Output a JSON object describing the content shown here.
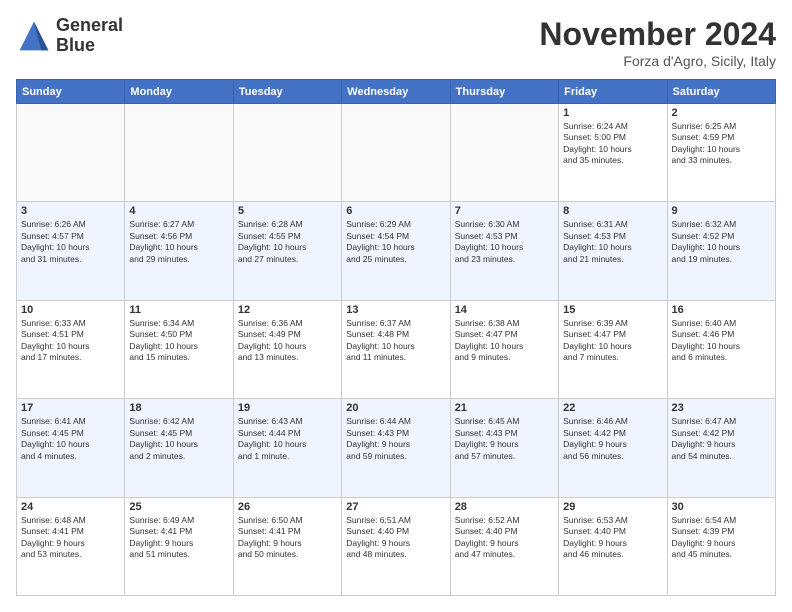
{
  "header": {
    "logo_line1": "General",
    "logo_line2": "Blue",
    "month": "November 2024",
    "location": "Forza d'Agro, Sicily, Italy"
  },
  "weekdays": [
    "Sunday",
    "Monday",
    "Tuesday",
    "Wednesday",
    "Thursday",
    "Friday",
    "Saturday"
  ],
  "weeks": [
    [
      {
        "day": "",
        "text": ""
      },
      {
        "day": "",
        "text": ""
      },
      {
        "day": "",
        "text": ""
      },
      {
        "day": "",
        "text": ""
      },
      {
        "day": "",
        "text": ""
      },
      {
        "day": "1",
        "text": "Sunrise: 6:24 AM\nSunset: 5:00 PM\nDaylight: 10 hours\nand 35 minutes."
      },
      {
        "day": "2",
        "text": "Sunrise: 6:25 AM\nSunset: 4:59 PM\nDaylight: 10 hours\nand 33 minutes."
      }
    ],
    [
      {
        "day": "3",
        "text": "Sunrise: 6:26 AM\nSunset: 4:57 PM\nDaylight: 10 hours\nand 31 minutes."
      },
      {
        "day": "4",
        "text": "Sunrise: 6:27 AM\nSunset: 4:56 PM\nDaylight: 10 hours\nand 29 minutes."
      },
      {
        "day": "5",
        "text": "Sunrise: 6:28 AM\nSunset: 4:55 PM\nDaylight: 10 hours\nand 27 minutes."
      },
      {
        "day": "6",
        "text": "Sunrise: 6:29 AM\nSunset: 4:54 PM\nDaylight: 10 hours\nand 25 minutes."
      },
      {
        "day": "7",
        "text": "Sunrise: 6:30 AM\nSunset: 4:53 PM\nDaylight: 10 hours\nand 23 minutes."
      },
      {
        "day": "8",
        "text": "Sunrise: 6:31 AM\nSunset: 4:53 PM\nDaylight: 10 hours\nand 21 minutes."
      },
      {
        "day": "9",
        "text": "Sunrise: 6:32 AM\nSunset: 4:52 PM\nDaylight: 10 hours\nand 19 minutes."
      }
    ],
    [
      {
        "day": "10",
        "text": "Sunrise: 6:33 AM\nSunset: 4:51 PM\nDaylight: 10 hours\nand 17 minutes."
      },
      {
        "day": "11",
        "text": "Sunrise: 6:34 AM\nSunset: 4:50 PM\nDaylight: 10 hours\nand 15 minutes."
      },
      {
        "day": "12",
        "text": "Sunrise: 6:36 AM\nSunset: 4:49 PM\nDaylight: 10 hours\nand 13 minutes."
      },
      {
        "day": "13",
        "text": "Sunrise: 6:37 AM\nSunset: 4:48 PM\nDaylight: 10 hours\nand 11 minutes."
      },
      {
        "day": "14",
        "text": "Sunrise: 6:38 AM\nSunset: 4:47 PM\nDaylight: 10 hours\nand 9 minutes."
      },
      {
        "day": "15",
        "text": "Sunrise: 6:39 AM\nSunset: 4:47 PM\nDaylight: 10 hours\nand 7 minutes."
      },
      {
        "day": "16",
        "text": "Sunrise: 6:40 AM\nSunset: 4:46 PM\nDaylight: 10 hours\nand 6 minutes."
      }
    ],
    [
      {
        "day": "17",
        "text": "Sunrise: 6:41 AM\nSunset: 4:45 PM\nDaylight: 10 hours\nand 4 minutes."
      },
      {
        "day": "18",
        "text": "Sunrise: 6:42 AM\nSunset: 4:45 PM\nDaylight: 10 hours\nand 2 minutes."
      },
      {
        "day": "19",
        "text": "Sunrise: 6:43 AM\nSunset: 4:44 PM\nDaylight: 10 hours\nand 1 minute."
      },
      {
        "day": "20",
        "text": "Sunrise: 6:44 AM\nSunset: 4:43 PM\nDaylight: 9 hours\nand 59 minutes."
      },
      {
        "day": "21",
        "text": "Sunrise: 6:45 AM\nSunset: 4:43 PM\nDaylight: 9 hours\nand 57 minutes."
      },
      {
        "day": "22",
        "text": "Sunrise: 6:46 AM\nSunset: 4:42 PM\nDaylight: 9 hours\nand 56 minutes."
      },
      {
        "day": "23",
        "text": "Sunrise: 6:47 AM\nSunset: 4:42 PM\nDaylight: 9 hours\nand 54 minutes."
      }
    ],
    [
      {
        "day": "24",
        "text": "Sunrise: 6:48 AM\nSunset: 4:41 PM\nDaylight: 9 hours\nand 53 minutes."
      },
      {
        "day": "25",
        "text": "Sunrise: 6:49 AM\nSunset: 4:41 PM\nDaylight: 9 hours\nand 51 minutes."
      },
      {
        "day": "26",
        "text": "Sunrise: 6:50 AM\nSunset: 4:41 PM\nDaylight: 9 hours\nand 50 minutes."
      },
      {
        "day": "27",
        "text": "Sunrise: 6:51 AM\nSunset: 4:40 PM\nDaylight: 9 hours\nand 48 minutes."
      },
      {
        "day": "28",
        "text": "Sunrise: 6:52 AM\nSunset: 4:40 PM\nDaylight: 9 hours\nand 47 minutes."
      },
      {
        "day": "29",
        "text": "Sunrise: 6:53 AM\nSunset: 4:40 PM\nDaylight: 9 hours\nand 46 minutes."
      },
      {
        "day": "30",
        "text": "Sunrise: 6:54 AM\nSunset: 4:39 PM\nDaylight: 9 hours\nand 45 minutes."
      }
    ]
  ]
}
